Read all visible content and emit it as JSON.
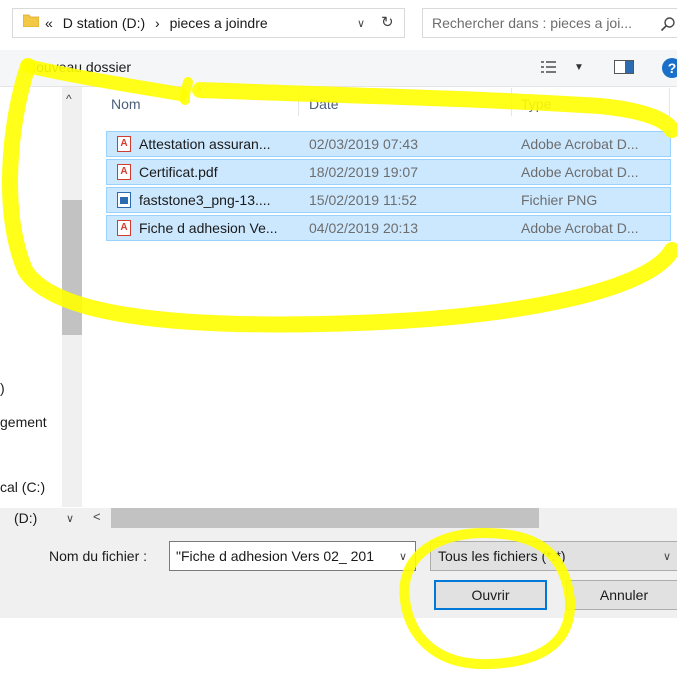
{
  "address": {
    "overflow": "«",
    "drive": "D station (D:)",
    "separator": "›",
    "folder": "pieces a joindre",
    "dropdown": "∨",
    "refresh": "↻"
  },
  "search": {
    "placeholder": "Rechercher dans : pieces a joi...",
    "icon": "search-icon"
  },
  "toolbar": {
    "new_folder": "Nouveau dossier",
    "view_dropdown": "▼",
    "help": "?"
  },
  "columns": {
    "name": "Nom",
    "date": "Date",
    "type": "Type",
    "sort_caret": "^"
  },
  "files": [
    {
      "name": "Attestation assuran...",
      "date": "02/03/2019 07:43",
      "type": "Adobe Acrobat D...",
      "icon": "pdf"
    },
    {
      "name": "Certificat.pdf",
      "date": "18/02/2019 19:07",
      "type": "Adobe Acrobat D...",
      "icon": "pdf"
    },
    {
      "name": "faststone3_png-13....",
      "date": "15/02/2019 11:52",
      "type": "Fichier PNG",
      "icon": "png"
    },
    {
      "name": "Fiche d adhesion Ve...",
      "date": "04/02/2019 20:13",
      "type": "Adobe Acrobat D...",
      "icon": "pdf"
    }
  ],
  "nav": {
    "item1": ")",
    "item2": "gement",
    "item3": "cal (C:)",
    "item4": "(D:)",
    "chevron": "∨",
    "up": "^",
    "left_arrow": "<"
  },
  "bottom": {
    "filename_label": "Nom du fichier :",
    "filename_value": "\"Fiche d adhesion Vers  02_ 201",
    "filetype_value": "Tous les fichiers (*.*)",
    "open_button": "Ouvrir",
    "cancel_button": "Annuler",
    "dropdown": "∨"
  },
  "colors": {
    "selection": "#cce8ff",
    "selection_border": "#99d1ff",
    "highlighter": "#ffff00",
    "accent": "#0078d7"
  }
}
